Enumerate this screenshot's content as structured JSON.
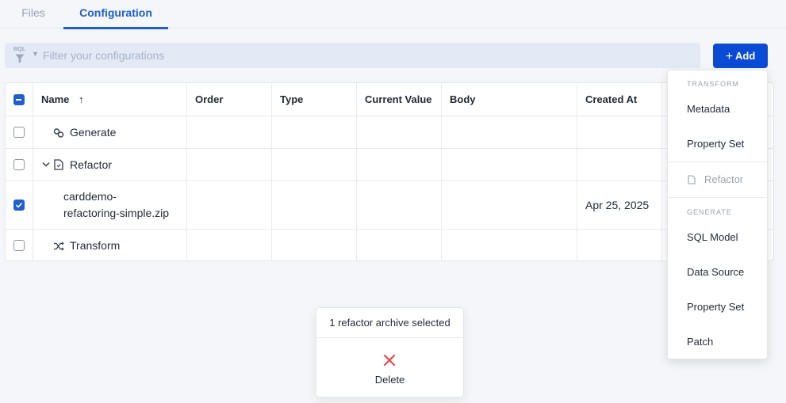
{
  "tabs": [
    {
      "label": "Files",
      "active": false
    },
    {
      "label": "Configuration",
      "active": true
    }
  ],
  "filter": {
    "badge": "BQL",
    "placeholder": "Filter your configurations",
    "value": ""
  },
  "add_button": {
    "label": "Add",
    "icon": "plus-icon"
  },
  "table": {
    "columns": [
      "Name",
      "Order",
      "Type",
      "Current Value",
      "Body",
      "Created At"
    ],
    "sort_indicator": "↑",
    "rows": [
      {
        "name": "Generate",
        "icon": "link-icon",
        "checked": false,
        "created_at": ""
      },
      {
        "name": "Refactor",
        "icon": "document-icon",
        "expanded": true,
        "checked": false,
        "created_at": ""
      },
      {
        "name_line1": "carddemo-",
        "name_line2": "refactoring-simple.zip",
        "checked": true,
        "created_at": "Apr 25, 2025"
      },
      {
        "name": "Transform",
        "icon": "shuffle-icon",
        "checked": false,
        "created_at": ""
      }
    ]
  },
  "add_menu": {
    "section_transform": "TRANSFORM",
    "transform_items": [
      "Metadata",
      "Property Set"
    ],
    "refactor_item": "Refactor",
    "section_generate": "GENERATE",
    "generate_items": [
      "SQL Model",
      "Data Source",
      "Property Set",
      "Patch"
    ]
  },
  "selection_popup": {
    "title": "1 refactor archive selected",
    "delete_label": "Delete"
  },
  "colors": {
    "accent": "#1f5fd1",
    "button": "#0a4bd6",
    "danger": "#e5484d"
  }
}
